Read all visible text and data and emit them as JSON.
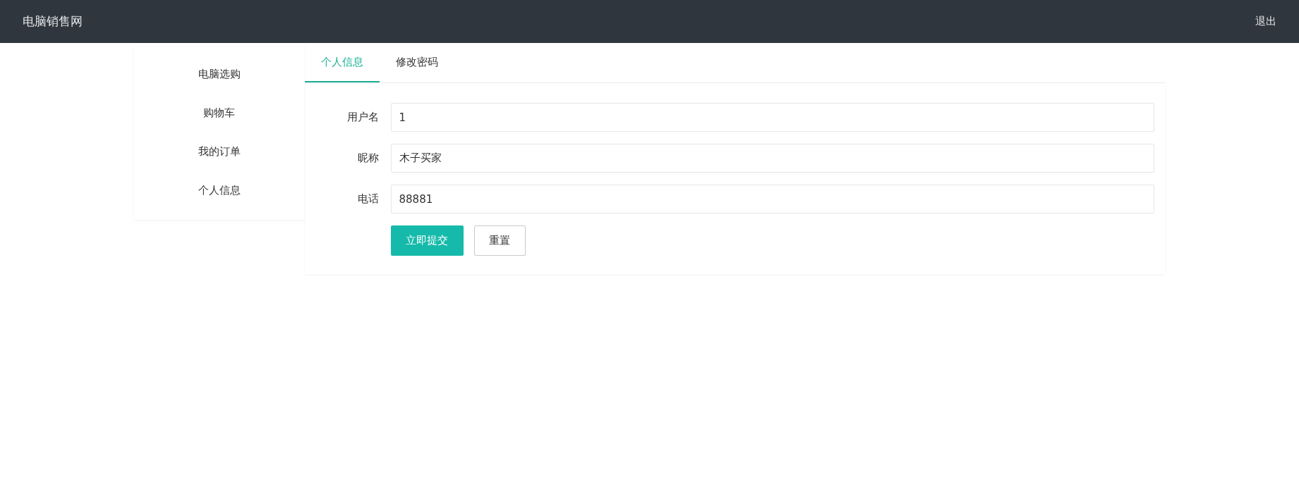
{
  "header": {
    "title": "电脑销售网",
    "logout": "退出"
  },
  "sidebar": {
    "items": [
      {
        "label": "电脑选购"
      },
      {
        "label": "购物车"
      },
      {
        "label": "我的订单"
      },
      {
        "label": "个人信息"
      }
    ]
  },
  "tabs": [
    {
      "label": "个人信息",
      "selected": true
    },
    {
      "label": "修改密码",
      "selected": false
    }
  ],
  "form": {
    "fields": [
      {
        "label": "用户名",
        "value": "1"
      },
      {
        "label": "昵称",
        "value": "木子买家"
      },
      {
        "label": "电话",
        "value": "88881"
      }
    ],
    "submit": "立即提交",
    "reset": "重置"
  }
}
